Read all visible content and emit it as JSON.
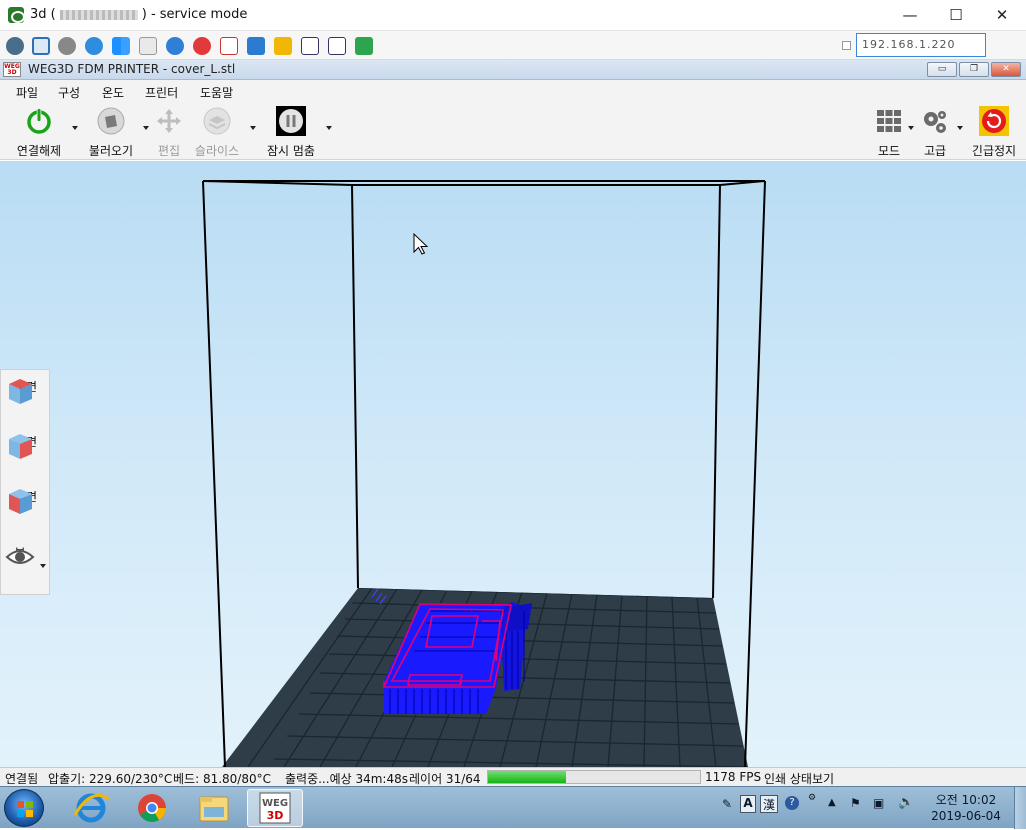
{
  "outer_window": {
    "title_prefix": "3d (",
    "title_suffix": ") - service mode",
    "minimize": "—",
    "maximize": "☐",
    "close": "✕",
    "address": "192.168.1.220"
  },
  "inner_window": {
    "title": "WEG3D FDM PRINTER - cover_L.stl",
    "logo_text": "WEG 3D",
    "minimize": "▭",
    "restore": "❐",
    "close": "✕"
  },
  "menu": [
    "파일",
    "구성",
    "온도",
    "프린터",
    "도움말"
  ],
  "toolbar": {
    "disconnect": "연결해제",
    "load": "불러오기",
    "edit": "편집",
    "slice": "슬라이스",
    "pause": "잠시 멈춤",
    "mode": "모드",
    "advanced": "고급",
    "emergency_stop": "긴급정지"
  },
  "view_panel": {
    "top": "평면",
    "side": "측면",
    "front": "정면",
    "view": "뷰"
  },
  "status": {
    "connected": "연결됨",
    "extruder": "압출기: 229.60/230°C",
    "bed": "베드: 81.80/80°C",
    "printing": "출력중...예상 34m:48s",
    "layer": "레이어 31/64",
    "progress_fraction": 0.37,
    "fps": "1178 FPS",
    "print_status_view": "인쇄 상태보기"
  },
  "taskbar": {
    "ime_mode": "A",
    "ime_hanja": "漢",
    "clock_time": "오전 10:02",
    "clock_date": "2019-06-04"
  },
  "colors": {
    "model": "#1a1aff",
    "outline": "#d8007a",
    "bed": "#1e2d38",
    "progress": "#15b315"
  }
}
